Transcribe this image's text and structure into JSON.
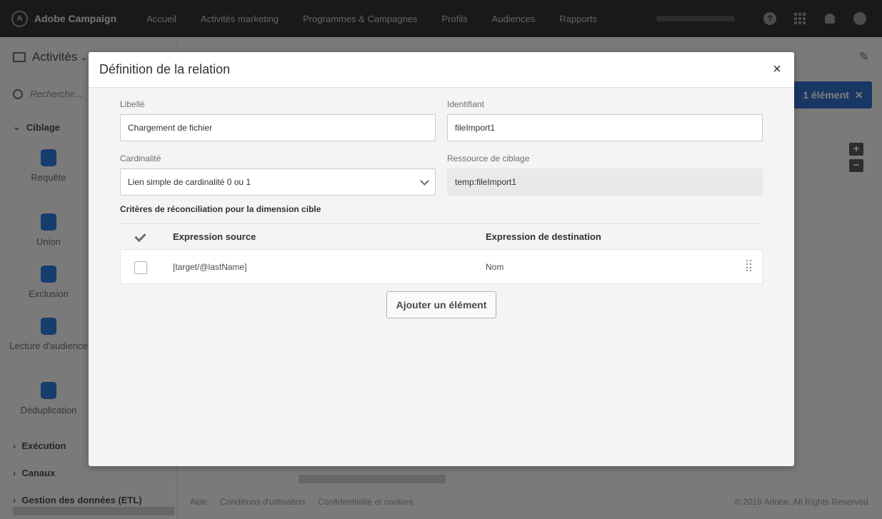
{
  "app": {
    "name": "Adobe Campaign",
    "nav": [
      "Accueil",
      "Activités marketing",
      "Programmes & Campagnes",
      "Profils",
      "Audiences",
      "Rapports"
    ]
  },
  "sidebar": {
    "title": "Activités",
    "search_placeholder": "Recherche...",
    "section_ciblage": "Ciblage",
    "items": [
      "Requête",
      "Union",
      "Exclusion",
      "Lecture d'audience",
      "Déduplication"
    ],
    "section_execution": "Exécution",
    "section_canaux": "Canaux",
    "section_etl": "Gestion des données (ETL)"
  },
  "canvas": {
    "selection_badge": "1 élément",
    "zoom_in": "+",
    "zoom_out": "−"
  },
  "footer": {
    "links": [
      "Aide",
      "Conditions d'utilisation",
      "Confidentialité et cookies"
    ],
    "copyright": "© 2019 Adobe. All Rights Reserved."
  },
  "modal": {
    "title": "Définition de la relation",
    "close": "×",
    "label_field": "Libellé",
    "label_value": "Chargement de fichier",
    "id_field": "Identifiant",
    "id_value": "fileImport1",
    "cardinality_field": "Cardinalité",
    "cardinality_value": "Lien simple de cardinalité 0 ou 1",
    "resource_field": "Ressource de ciblage",
    "resource_value": "temp:fileImport1",
    "criteria_title": "Critères de réconciliation pour la dimension cible",
    "col_source": "Expression source",
    "col_dest": "Expression de destination",
    "rows": [
      {
        "source": "[target/@lastName]",
        "dest": "Nom"
      }
    ],
    "add_button": "Ajouter un élément"
  },
  "colors": {
    "topnav": "#323232",
    "badge": "#326ec8",
    "modal_bg": "#f4f4f4"
  }
}
